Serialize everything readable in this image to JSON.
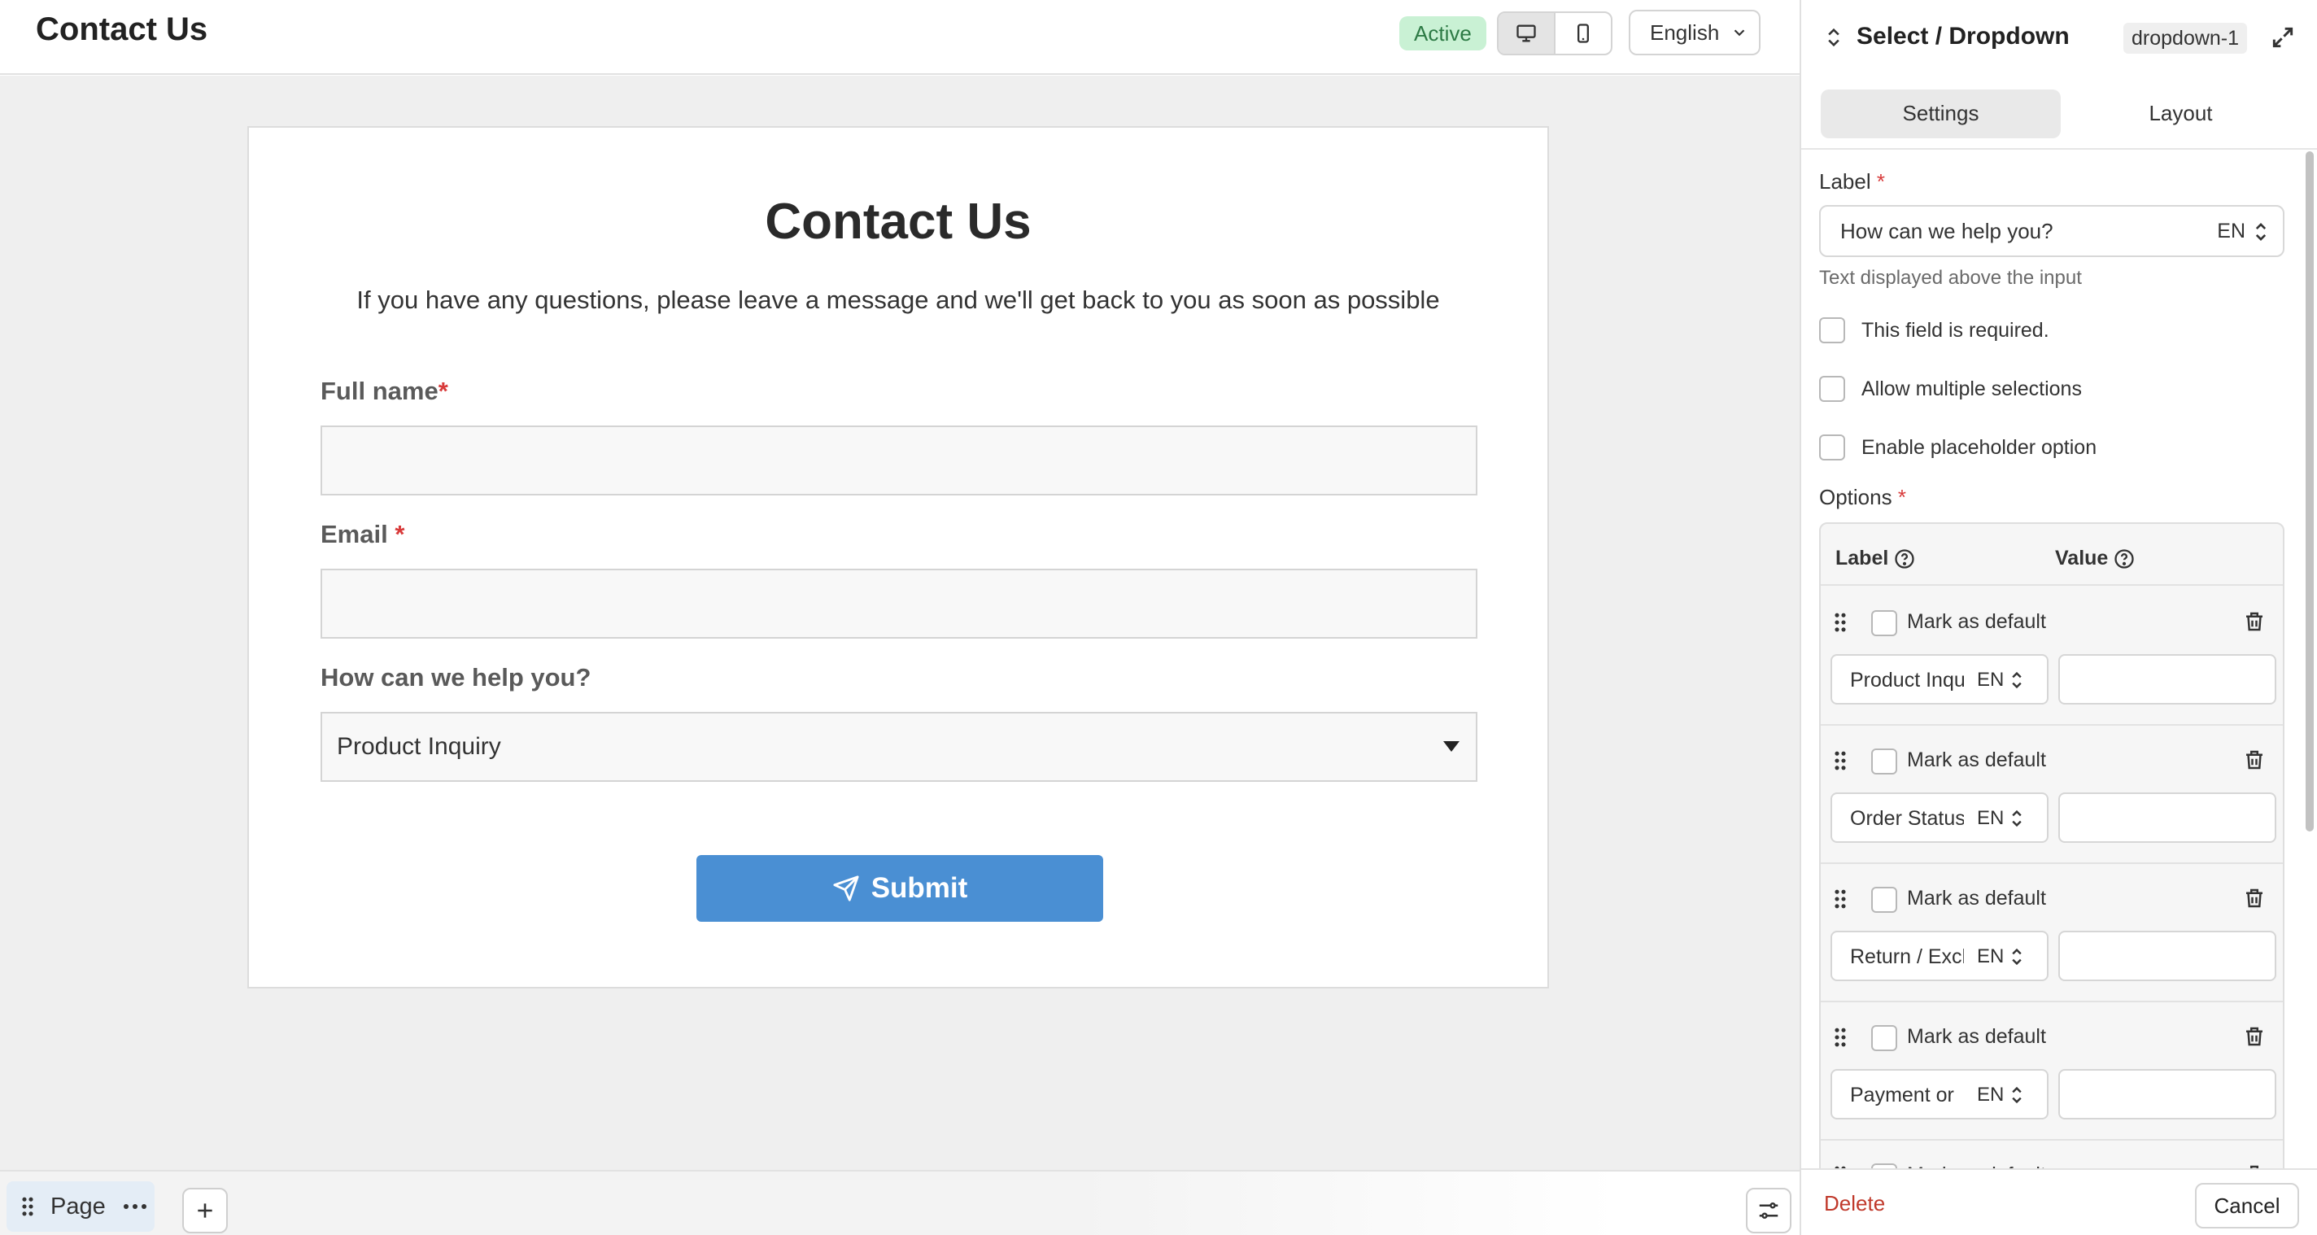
{
  "header": {
    "title": "Contact Us",
    "status_badge": "Active",
    "language": "English"
  },
  "form": {
    "heading": "Contact Us",
    "subtitle": "If you have any questions, please leave a message and we'll get back to you as soon as possible",
    "fields": {
      "full_name_label": "Full name",
      "email_label": "Email",
      "help_label": "How can we help you?",
      "required_marker": "*"
    },
    "select_value": "Product Inquiry",
    "submit_label": "Submit"
  },
  "bottom_bar": {
    "page_label": "Page"
  },
  "panel": {
    "title": "Select / Dropdown",
    "component_id": "dropdown-1",
    "tabs": [
      "Settings",
      "Layout"
    ],
    "label_field": {
      "label": "Label",
      "value": "How can we help you?",
      "lang": "EN",
      "hint": "Text displayed above the input"
    },
    "checkboxes": [
      "This field is required.",
      "Allow multiple selections",
      "Enable placeholder option"
    ],
    "options": {
      "title": "Options",
      "col_label": "Label",
      "col_value": "Value",
      "mark_default_label": "Mark as default",
      "items": [
        {
          "label": "Product Inquiry",
          "lang": "EN"
        },
        {
          "label": "Order Status",
          "lang": "EN"
        },
        {
          "label": "Return / Exchange",
          "lang": "EN"
        },
        {
          "label": "Payment or",
          "lang": "EN"
        }
      ]
    },
    "footer": {
      "delete": "Delete",
      "cancel": "Cancel"
    }
  },
  "colors": {
    "accent": "#4a8fd3",
    "active_badge_bg": "#c9f1d4",
    "required": "#d83a3a",
    "delete": "#c0392b"
  }
}
